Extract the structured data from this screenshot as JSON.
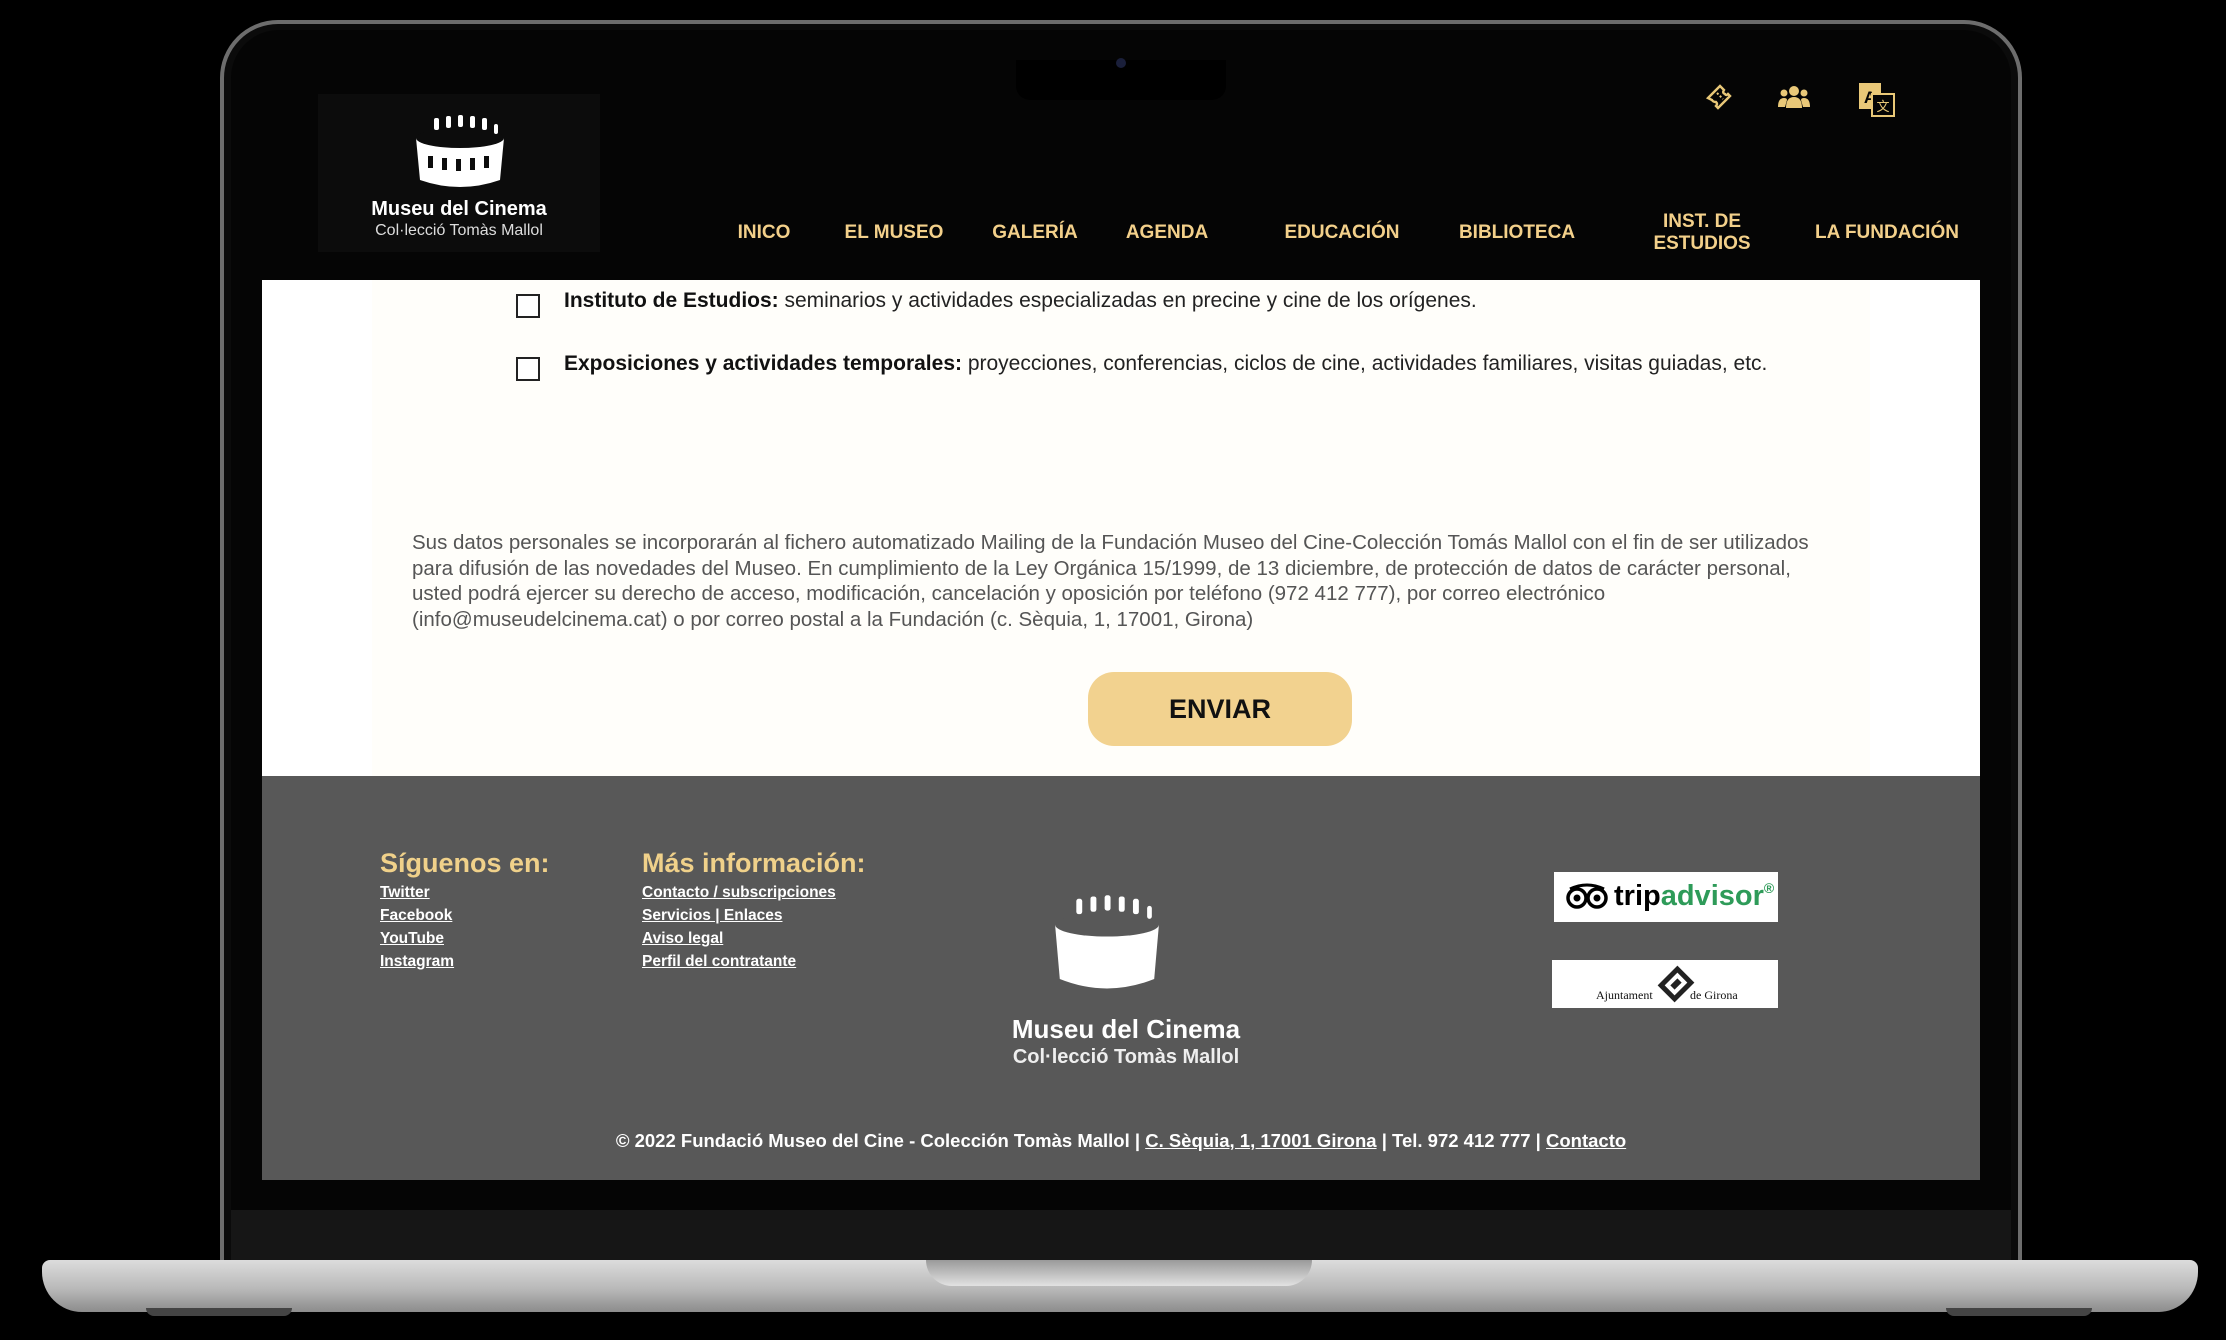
{
  "logo": {
    "title": "Museu del Cinema",
    "subtitle": "Col·lecció Tomàs Mallol"
  },
  "top_icons": [
    "ticket-icon",
    "group-icon",
    "translate-icon"
  ],
  "nav": {
    "items": [
      {
        "label": "INICO"
      },
      {
        "label": "EL MUSEO"
      },
      {
        "label": "GALERÍA"
      },
      {
        "label": "AGENDA"
      },
      {
        "label": "EDUCACIÓN"
      },
      {
        "label": "BIBLIOTECA"
      },
      {
        "label": "INST. DE ESTUDIOS"
      },
      {
        "label": "LA FUNDACIÓN"
      }
    ]
  },
  "form": {
    "options": [
      {
        "bold": "Instituto de Estudios:",
        "text": " seminarios y actividades especializadas en precine y cine de los orígenes.",
        "checked": false
      },
      {
        "bold": "Exposiciones y actividades temporales:",
        "text": " proyecciones, conferencias, ciclos de cine, actividades familiares, visitas guiadas, etc.",
        "checked": false
      }
    ],
    "privacy": "Sus datos personales se incorporarán al fichero automatizado Mailing de la Fundación Museo del Cine-Colección Tomás Mallol con el fin de ser utilizados para difusión de las novedades del Museo. En cumplimiento de la Ley Orgánica 15/1999, de 13 diciembre, de protección de datos de carácter personal, usted podrá ejercer su derecho de acceso, modificación, cancelación y oposición por teléfono (972 412 777), por correo electrónico (info@museudelcinema.cat) o por correo postal a la Fundación (c. Sèquia, 1, 17001, Girona)",
    "submit_label": "ENVIAR"
  },
  "footer": {
    "follow_heading": "Síguenos en:",
    "social": [
      "Twitter",
      "Facebook",
      "YouTube",
      "Instagram"
    ],
    "info_heading": "Más información:",
    "info_links": [
      "Contacto / subscripciones",
      "Servicios | Enlaces",
      "Aviso legal",
      "Perfil del contratante"
    ],
    "logo_title": "Museu del Cinema",
    "logo_subtitle": "Col·lecció Tomàs Mallol",
    "tripadvisor": {
      "trip": "trip",
      "advisor": "advisor",
      "reg": "®"
    },
    "ajuntament": {
      "left": "Ajuntament",
      "right": "de Girona"
    },
    "copyright_text": "© 2022 Fundació Museo del Cine - Colección Tomàs Mallol | ",
    "address_link": "C. Sèquia, 1, 17001 Girona",
    "phone_text": " | Tel. 972 412 777 | ",
    "contact_link": "Contacto"
  },
  "colors": {
    "nav_gold": "#f3d08a",
    "button_bg": "#f2d28f",
    "footer_bg": "#585858",
    "heading_gold": "#f0d18a"
  }
}
